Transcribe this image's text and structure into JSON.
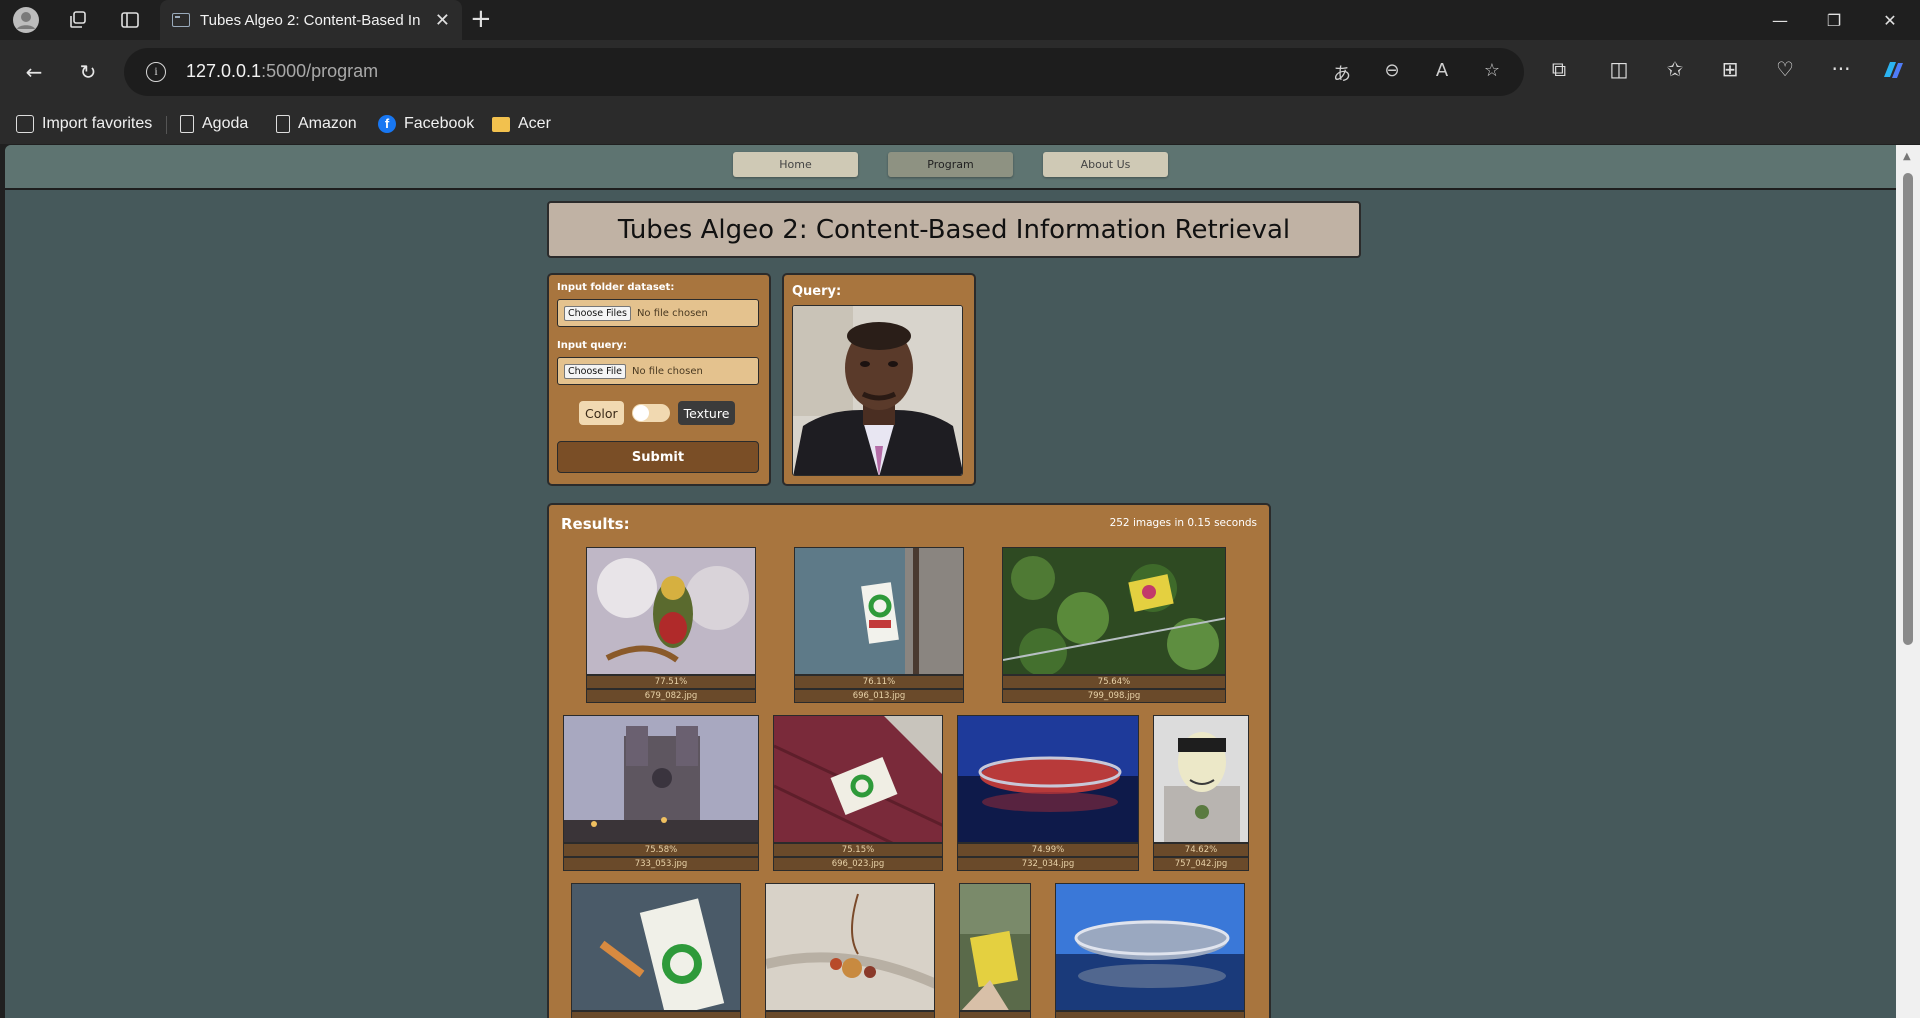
{
  "browser": {
    "tab_title": "Tubes Algeo 2: Content-Based Information Retrieval",
    "url_host": "127.0.0.1",
    "url_path": ":5000/program",
    "bookmarks": [
      "Import favorites",
      "Agoda",
      "Amazon",
      "Facebook",
      "Acer"
    ]
  },
  "nav": {
    "home": "Home",
    "program": "Program",
    "about": "About Us"
  },
  "page_title": "Tubes Algeo 2: Content-Based Information Retrieval",
  "form": {
    "dataset_label": "Input folder dataset:",
    "dataset_button": "Choose Files",
    "dataset_status": "No file chosen",
    "query_label": "Input query:",
    "query_button": "Choose File",
    "query_status": "No file chosen",
    "color_label": "Color",
    "texture_label": "Texture",
    "submit_label": "Submit"
  },
  "query": {
    "label": "Query:"
  },
  "results": {
    "title": "Results:",
    "summary": "252 images in 0.15 seconds",
    "items": [
      {
        "pct": "77.51%",
        "name": "679_082.jpg"
      },
      {
        "pct": "76.11%",
        "name": "696_013.jpg"
      },
      {
        "pct": "75.64%",
        "name": "799_098.jpg"
      },
      {
        "pct": "75.58%",
        "name": "733_053.jpg"
      },
      {
        "pct": "75.15%",
        "name": "696_023.jpg"
      },
      {
        "pct": "74.99%",
        "name": "732_034.jpg"
      },
      {
        "pct": "74.62%",
        "name": "757_042.jpg"
      },
      {
        "pct": "",
        "name": ""
      },
      {
        "pct": "",
        "name": ""
      },
      {
        "pct": "",
        "name": ""
      },
      {
        "pct": "",
        "name": ""
      }
    ]
  }
}
